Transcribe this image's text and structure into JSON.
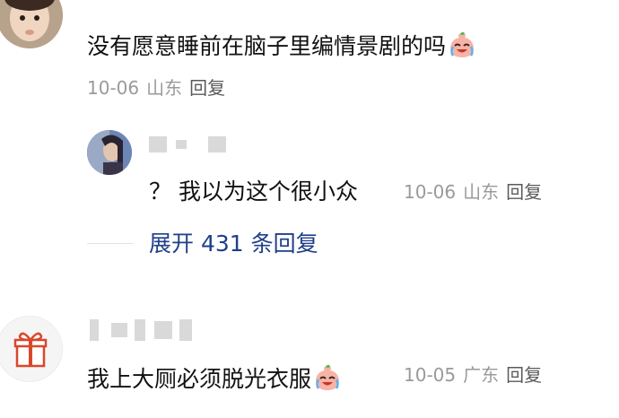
{
  "comments": [
    {
      "text": "没有愿意睡前在脑子里编情景剧的吗",
      "date": "10-06",
      "location": "山东",
      "reply_label": "回复",
      "emoji": "crying-laughing-peach-emoji"
    },
    {
      "text": "我上大厕必须脱光衣服",
      "date": "10-05",
      "location": "广东",
      "reply_label": "回复",
      "emoji": "crying-laughing-peach-emoji"
    }
  ],
  "replies": [
    {
      "text": "？ 我以为这个很小众",
      "date": "10-06",
      "location": "山东",
      "reply_label": "回复"
    }
  ],
  "expand_label": "展开 431 条回复",
  "colors": {
    "link_blue": "#1e3f8a",
    "meta_gray": "#9a9a9a",
    "text": "#111111"
  }
}
